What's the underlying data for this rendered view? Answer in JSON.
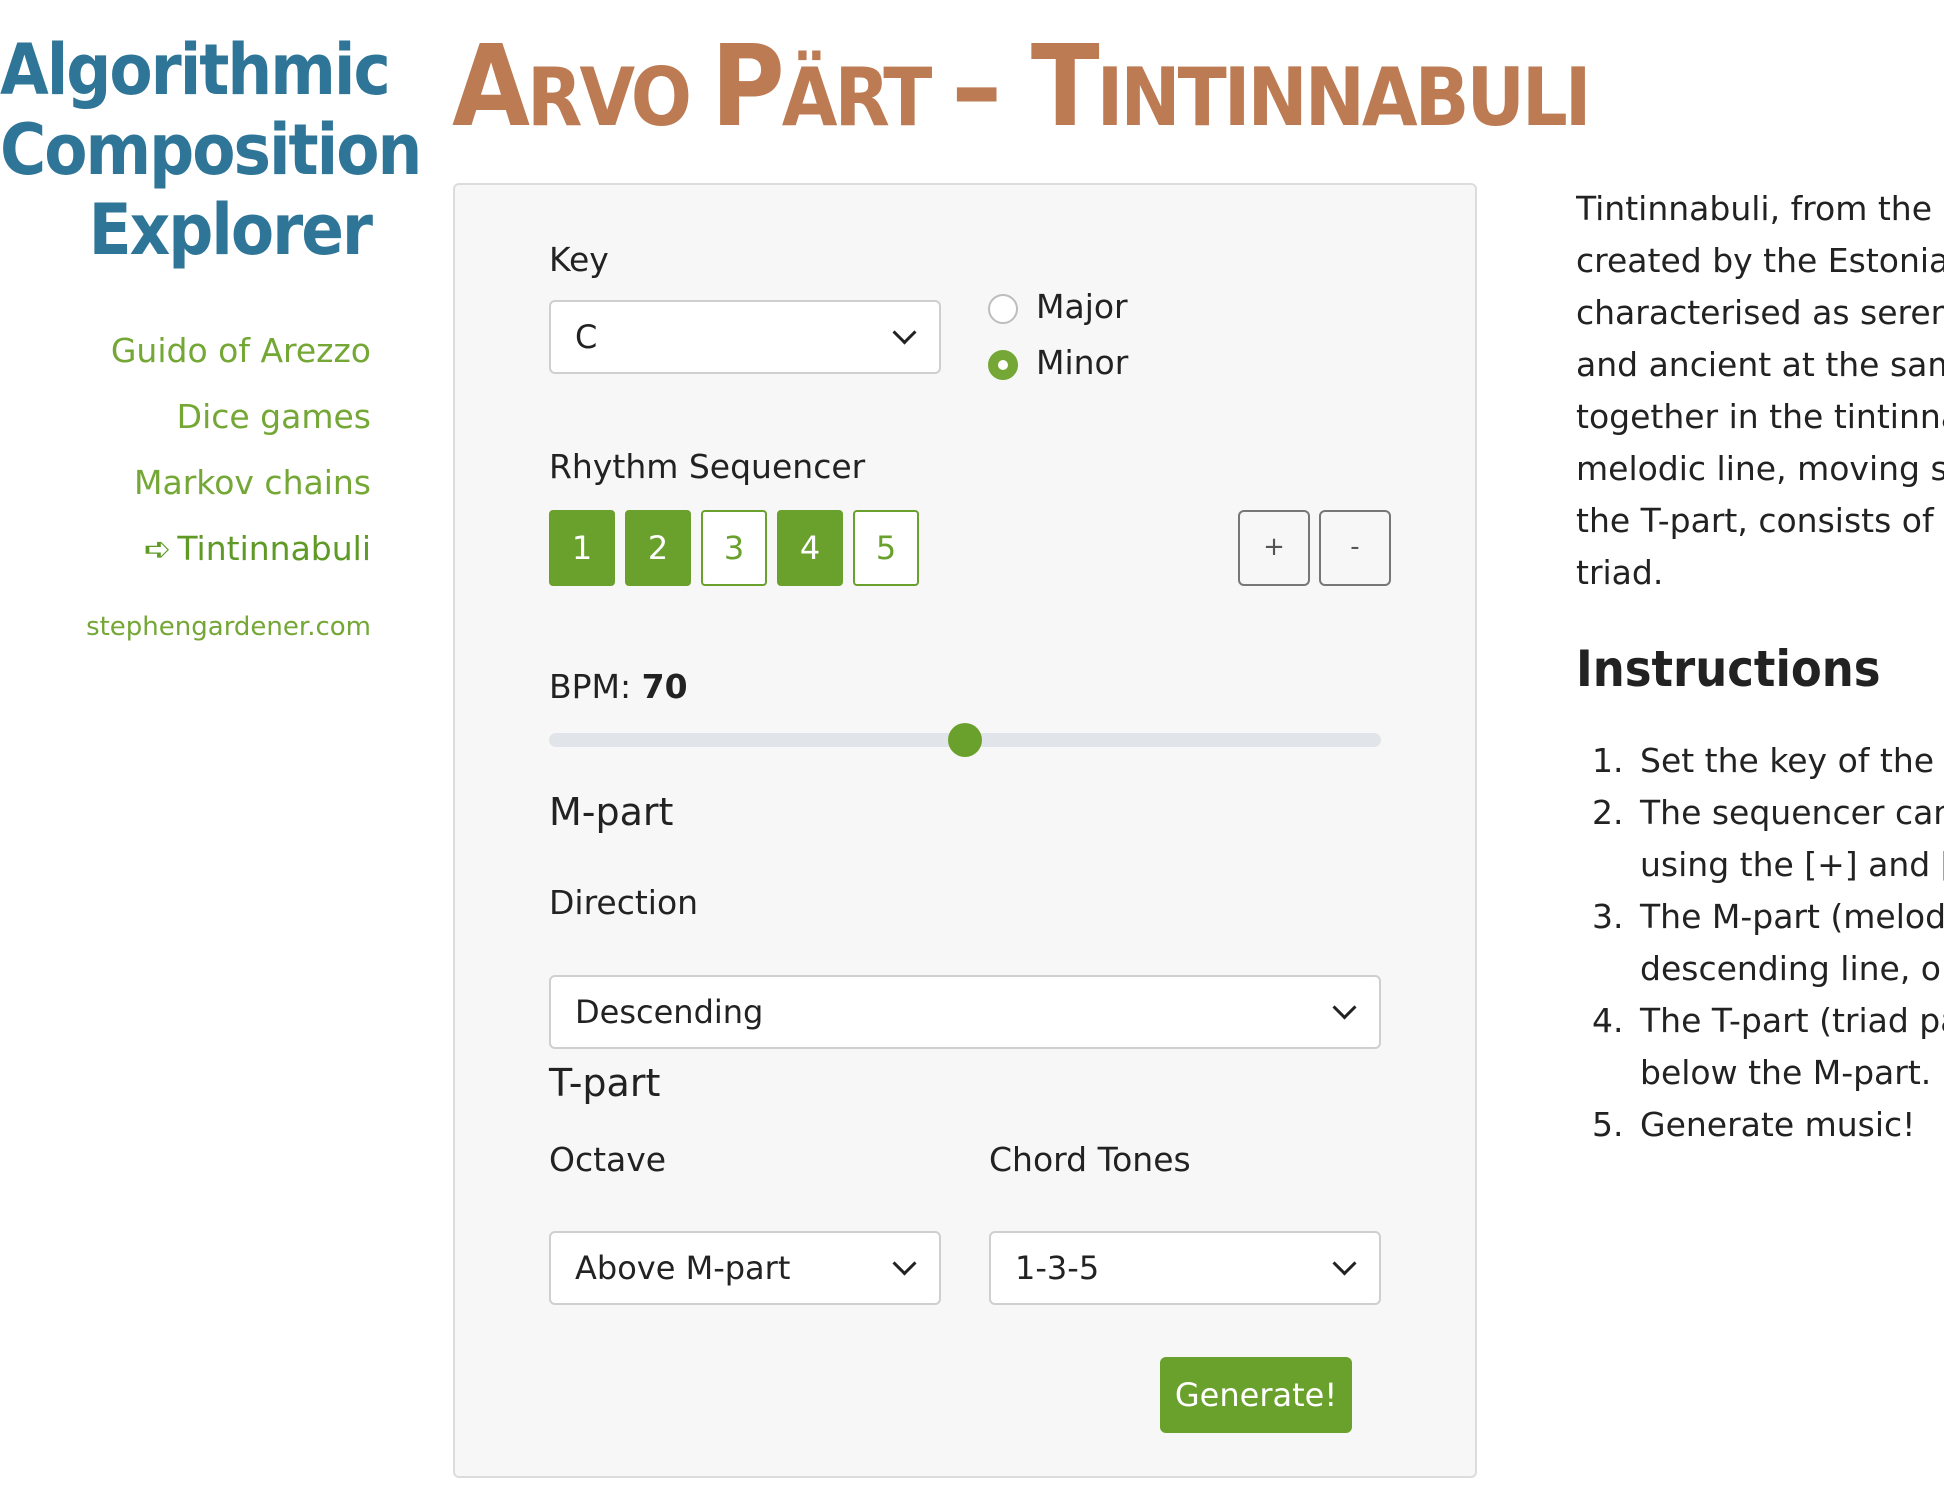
{
  "sidebar": {
    "title_lines": [
      "Algorithmic",
      "Composition",
      "Explorer"
    ],
    "nav": [
      {
        "label": "Guido of Arezzo"
      },
      {
        "label": "Dice games"
      },
      {
        "label": "Markov chains"
      },
      {
        "label": "Tintinnabuli",
        "active": true,
        "marker": "➪"
      }
    ],
    "site_link": "stephengardener.com"
  },
  "page": {
    "title_parts": [
      "A",
      "RVO ",
      "P",
      "ÄRT ",
      "– ",
      "T",
      "INTINNABULI"
    ]
  },
  "panel": {
    "key_label": "Key",
    "key_value": "C",
    "mode_options": [
      {
        "label": "Major",
        "checked": false
      },
      {
        "label": "Minor",
        "checked": true
      }
    ],
    "rhythm_label": "Rhythm Sequencer",
    "steps": [
      {
        "label": "1",
        "on": true
      },
      {
        "label": "2",
        "on": true
      },
      {
        "label": "3",
        "on": false
      },
      {
        "label": "4",
        "on": true
      },
      {
        "label": "5",
        "on": false
      }
    ],
    "plus_label": "+",
    "minus_label": "-",
    "bpm_label": "BPM:",
    "bpm_value": "70",
    "bpm_slider_fraction": 0.5,
    "mpart_heading": "M-part",
    "direction_label": "Direction",
    "direction_value": "Descending",
    "tpart_heading": "T-part",
    "octave_label": "Octave",
    "octave_value": "Above M-part",
    "chord_label": "Chord Tones",
    "chord_value": "1-3-5",
    "generate_label": "Generate!"
  },
  "intro_lines": [
    "Tintinnabuli, from the Lat",
    "created by the Estonian c",
    "characterised as serene a",
    "and ancient at the same",
    "together in the tintinnabu",
    "melodic line, moving step",
    "the T-part, consists of ch",
    "triad."
  ],
  "instructions": {
    "title": "Instructions",
    "items": [
      {
        "num": "1.",
        "lines": [
          "Set the key of the pie"
        ]
      },
      {
        "num": "2.",
        "lines": [
          "The sequencer can b",
          "using the [+] and [-]"
        ]
      },
      {
        "num": "3.",
        "lines": [
          "The M-part (melody",
          "descending line, or ju"
        ]
      },
      {
        "num": "4.",
        "lines": [
          "The T-part (triad par",
          "below the M-part."
        ]
      },
      {
        "num": "5.",
        "lines": [
          "Generate music!"
        ]
      }
    ]
  },
  "colors": {
    "title_blue": "#2f7597",
    "heading_brown": "#bd7b54",
    "accent_green": "#6aa12d"
  }
}
